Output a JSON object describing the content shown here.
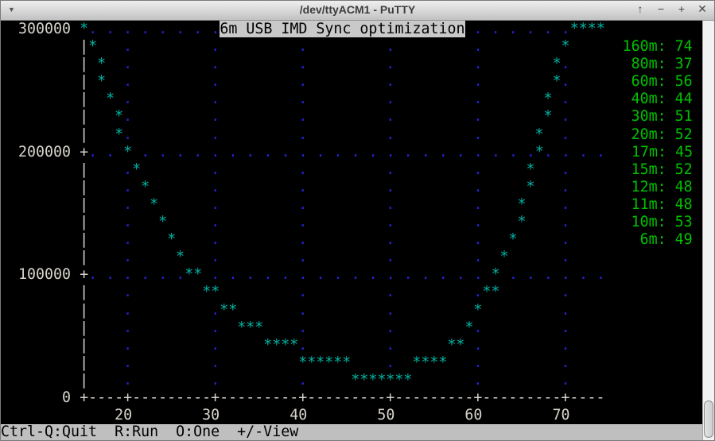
{
  "window": {
    "title": "/dev/ttyACM1 - PuTTY",
    "menu_icon": "▼",
    "buttons": [
      {
        "name": "shade",
        "glyph": "↑"
      },
      {
        "name": "minimize",
        "glyph": "−"
      },
      {
        "name": "maximize",
        "glyph": "+"
      },
      {
        "name": "close",
        "glyph": "✕"
      }
    ]
  },
  "status_bar": {
    "text": "Ctrl-Q:Quit  R:Run  O:One  +/-View"
  },
  "colors": {
    "background": "#000000",
    "grid_dot": "#2424d8",
    "axis": "#d8d4cc",
    "point": "#00b5a5",
    "legend": "#00c000",
    "title_fg": "#000000",
    "title_bg": "#c9c9c9"
  },
  "chart_data": {
    "type": "scatter",
    "title": "6m USB IMD Sync optimization",
    "marker": "*",
    "xlabel": "",
    "ylabel": "",
    "x_ticks": [
      20,
      30,
      40,
      50,
      60,
      70
    ],
    "y_ticks": [
      0,
      100000,
      200000,
      300000
    ],
    "x_range": [
      15,
      74
    ],
    "y_range": [
      0,
      300000
    ],
    "grid": "dotted",
    "legend_position": "right",
    "points": [
      [
        15,
        300000
      ],
      [
        16,
        285714
      ],
      [
        17,
        271429
      ],
      [
        17,
        257143
      ],
      [
        18,
        242857
      ],
      [
        19,
        228571
      ],
      [
        19,
        214286
      ],
      [
        20,
        200000
      ],
      [
        21,
        185714
      ],
      [
        22,
        171429
      ],
      [
        23,
        157143
      ],
      [
        24,
        142857
      ],
      [
        25,
        128571
      ],
      [
        26,
        114286
      ],
      [
        27,
        100000
      ],
      [
        28,
        100000
      ],
      [
        29,
        85714
      ],
      [
        30,
        85714
      ],
      [
        31,
        71429
      ],
      [
        32,
        71429
      ],
      [
        33,
        57143
      ],
      [
        34,
        57143
      ],
      [
        35,
        57143
      ],
      [
        36,
        42857
      ],
      [
        37,
        42857
      ],
      [
        38,
        42857
      ],
      [
        39,
        42857
      ],
      [
        40,
        28571
      ],
      [
        41,
        28571
      ],
      [
        42,
        28571
      ],
      [
        43,
        28571
      ],
      [
        44,
        28571
      ],
      [
        45,
        28571
      ],
      [
        46,
        14286
      ],
      [
        47,
        14286
      ],
      [
        48,
        14286
      ],
      [
        49,
        14286
      ],
      [
        50,
        14286
      ],
      [
        51,
        14286
      ],
      [
        52,
        14286
      ],
      [
        53,
        28571
      ],
      [
        54,
        28571
      ],
      [
        55,
        28571
      ],
      [
        56,
        28571
      ],
      [
        57,
        42857
      ],
      [
        58,
        42857
      ],
      [
        59,
        57143
      ],
      [
        60,
        71429
      ],
      [
        61,
        85714
      ],
      [
        62,
        85714
      ],
      [
        62,
        100000
      ],
      [
        63,
        114286
      ],
      [
        64,
        128571
      ],
      [
        65,
        142857
      ],
      [
        65,
        157143
      ],
      [
        66,
        171429
      ],
      [
        66,
        185714
      ],
      [
        67,
        200000
      ],
      [
        67,
        214286
      ],
      [
        68,
        228571
      ],
      [
        68,
        242857
      ],
      [
        69,
        257143
      ],
      [
        69,
        271429
      ],
      [
        70,
        285714
      ],
      [
        71,
        300000
      ],
      [
        72,
        300000
      ],
      [
        73,
        300000
      ],
      [
        74,
        300000
      ]
    ],
    "legend": [
      {
        "band": "160m",
        "value": 74
      },
      {
        "band": "80m",
        "value": 37
      },
      {
        "band": "60m",
        "value": 56
      },
      {
        "band": "40m",
        "value": 44
      },
      {
        "band": "30m",
        "value": 51
      },
      {
        "band": "20m",
        "value": 52
      },
      {
        "band": "17m",
        "value": 45
      },
      {
        "band": "15m",
        "value": 52
      },
      {
        "band": "12m",
        "value": 48
      },
      {
        "band": "11m",
        "value": 48
      },
      {
        "band": "10m",
        "value": 53
      },
      {
        "band": "6m",
        "value": 49
      }
    ]
  },
  "terminal_render": {
    "cols": 80,
    "rows": 23,
    "axis_col": 9,
    "axis_row": 21,
    "title_row": 0,
    "title_col": 25,
    "legend_start_row": 1,
    "legend_end_col": 78,
    "ylabel_end_col": 7,
    "x_per_col": 1,
    "y_per_row": 14285.714
  }
}
